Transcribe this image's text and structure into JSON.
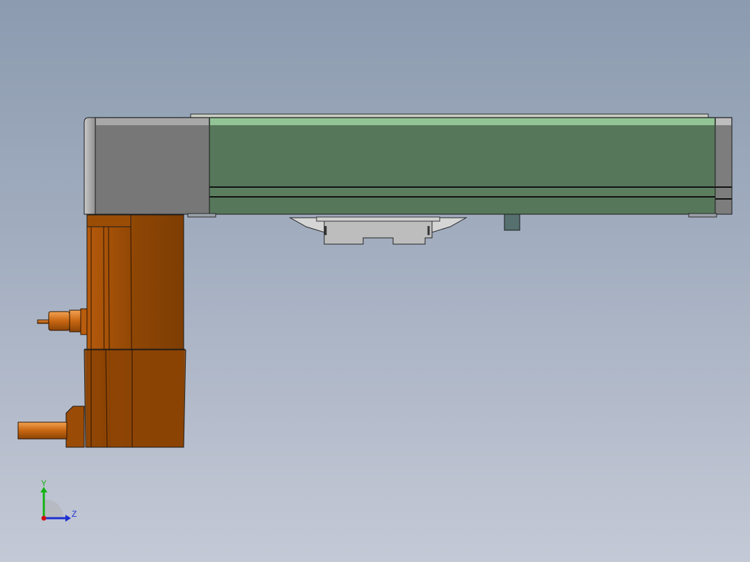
{
  "viewport": {
    "background_top": "#8c9bb0",
    "background_bottom": "#c4c9d6"
  },
  "model": {
    "description_colors": {
      "actuator_green": "#56775a",
      "actuator_green_highlight": "#93c496",
      "end_cap_gray": "#777777",
      "carriage_gray": "#b9b9b9",
      "motor_orange": "#8c4404",
      "motor_orange_highlight": "#d27019",
      "outline": "#1a1a1a"
    }
  },
  "triad": {
    "y_label": "Y",
    "z_label": "Z",
    "y_color": "#13b313",
    "z_color": "#1c2fd1",
    "x_color": "#d01010"
  }
}
